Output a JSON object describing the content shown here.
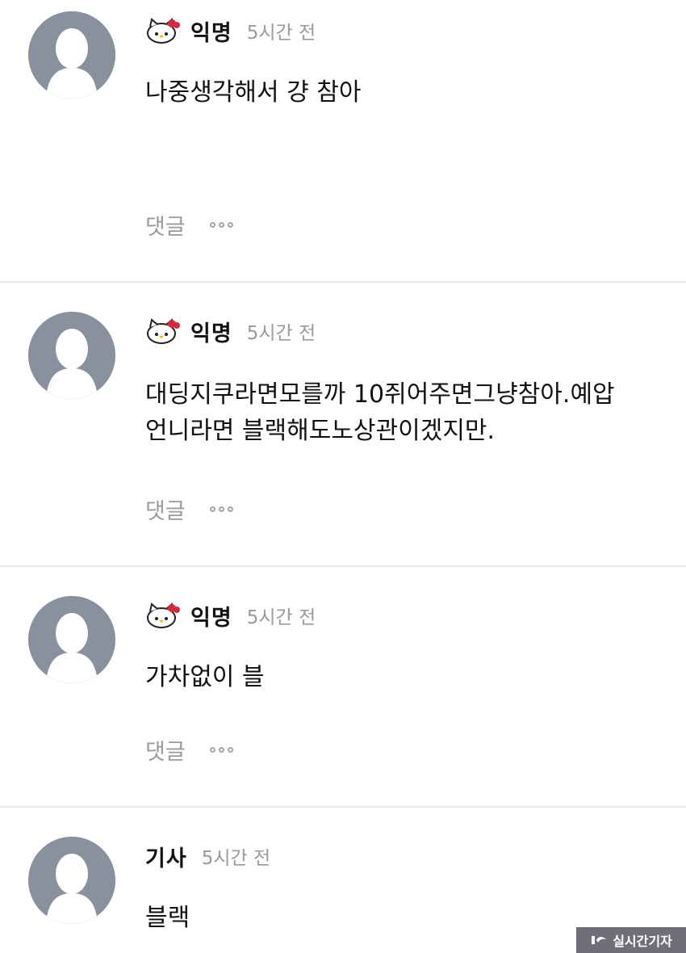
{
  "comments": [
    {
      "author": "익명",
      "time": "5시간 전",
      "text": "나중생각해서 걍 참아",
      "reply_label": "댓글",
      "badge": true
    },
    {
      "author": "익명",
      "time": "5시간 전",
      "text": "대딩지쿠라면모를까 10쥐어주면그냥참아.예압\n언니라면 블랙해도노상관이겠지만.",
      "reply_label": "댓글",
      "badge": true
    },
    {
      "author": "익명",
      "time": "5시간 전",
      "text": "가차없이 블",
      "reply_label": "댓글",
      "badge": true
    },
    {
      "author": "기사",
      "time": "5시간 전",
      "text": "블랙",
      "badge": false
    }
  ],
  "watermark": {
    "label": "실시간기자"
  },
  "icons": {
    "avatar": "default-user-avatar-icon",
    "badge": "hello-kitty-icon",
    "more": "more-dots-icon"
  },
  "colors": {
    "avatar_bg": "#8a919e",
    "muted_text": "#9a9a9a",
    "divider": "#e9e9e9"
  }
}
